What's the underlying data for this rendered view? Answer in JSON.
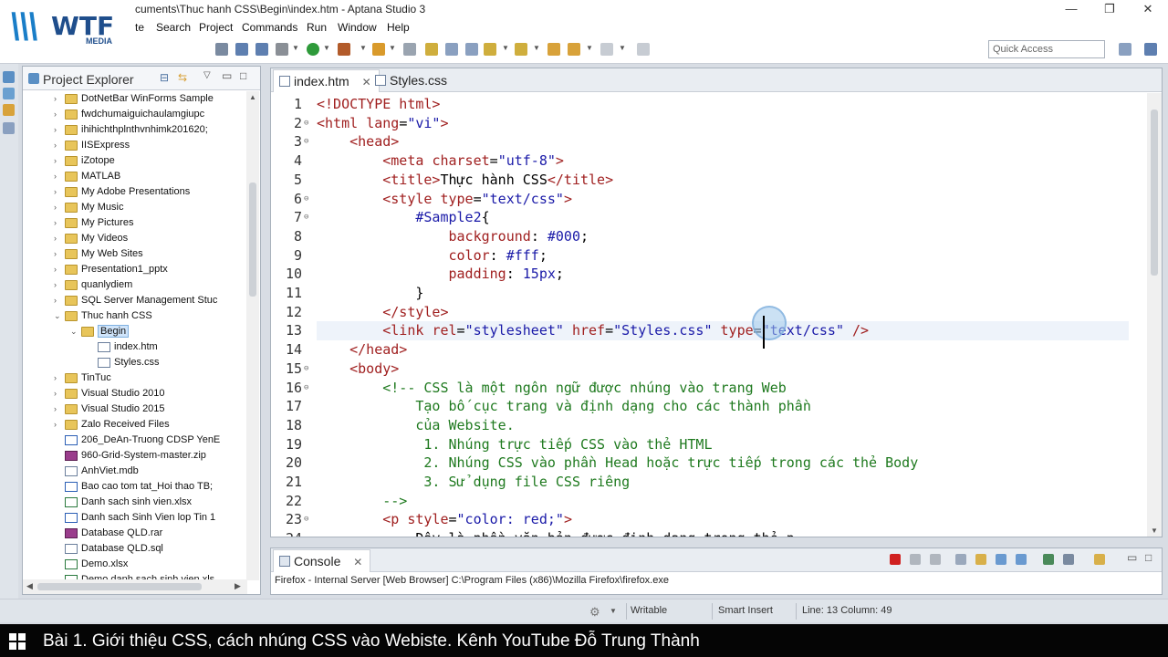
{
  "window": {
    "title": "cuments\\Thuc hanh CSS\\Begin\\index.htm - Aptana Studio 3",
    "minimize": "—",
    "restore": "❐",
    "close": "✕"
  },
  "logo": {
    "mark": "\\\\\\",
    "text": "WTF",
    "sub": "MEDIA"
  },
  "menu": [
    "te",
    "Search",
    "Project",
    "Commands",
    "Run",
    "Window",
    "Help"
  ],
  "quick_access": {
    "placeholder": "Quick Access"
  },
  "project_explorer": {
    "title": "Project Explorer",
    "items": [
      {
        "label": "DotNetBar WinForms Sample",
        "type": "folder",
        "depth": 1,
        "expanded": false
      },
      {
        "label": "fwdchumaiguichaulamgiupc",
        "type": "folder",
        "depth": 1,
        "expanded": false
      },
      {
        "label": "ihihichthplnthvnhimk201620;",
        "type": "folder",
        "depth": 1,
        "expanded": false
      },
      {
        "label": "IISExpress",
        "type": "folder",
        "depth": 1,
        "expanded": false
      },
      {
        "label": "iZotope",
        "type": "folder",
        "depth": 1,
        "expanded": false
      },
      {
        "label": "MATLAB",
        "type": "folder",
        "depth": 1,
        "expanded": false
      },
      {
        "label": "My Adobe Presentations",
        "type": "folder",
        "depth": 1,
        "expanded": false
      },
      {
        "label": "My Music",
        "type": "folder",
        "depth": 1,
        "expanded": false
      },
      {
        "label": "My Pictures",
        "type": "folder",
        "depth": 1,
        "expanded": false
      },
      {
        "label": "My Videos",
        "type": "folder",
        "depth": 1,
        "expanded": false
      },
      {
        "label": "My Web Sites",
        "type": "folder",
        "depth": 1,
        "expanded": false
      },
      {
        "label": "Presentation1_pptx",
        "type": "folder",
        "depth": 1,
        "expanded": false
      },
      {
        "label": "quanlydiem",
        "type": "folder",
        "depth": 1,
        "expanded": false
      },
      {
        "label": "SQL Server Management Stuc",
        "type": "folder",
        "depth": 1,
        "expanded": false
      },
      {
        "label": "Thuc hanh CSS",
        "type": "folder",
        "depth": 1,
        "expanded": true
      },
      {
        "label": "Begin",
        "type": "folder",
        "depth": 2,
        "expanded": true,
        "selected": true
      },
      {
        "label": "index.htm",
        "type": "file",
        "depth": 3
      },
      {
        "label": "Styles.css",
        "type": "file",
        "depth": 3
      },
      {
        "label": "TinTuc",
        "type": "folder",
        "depth": 1,
        "expanded": false
      },
      {
        "label": "Visual Studio 2010",
        "type": "folder",
        "depth": 1,
        "expanded": false
      },
      {
        "label": "Visual Studio 2015",
        "type": "folder",
        "depth": 1,
        "expanded": false
      },
      {
        "label": "Zalo Received Files",
        "type": "folder",
        "depth": 1,
        "expanded": false
      },
      {
        "label": "206_DeAn-Truong CDSP YenE",
        "type": "doc",
        "depth": 1
      },
      {
        "label": "960-Grid-System-master.zip",
        "type": "rar",
        "depth": 1
      },
      {
        "label": "AnhViet.mdb",
        "type": "file",
        "depth": 1
      },
      {
        "label": "Bao cao tom tat_Hoi thao TB;",
        "type": "doc",
        "depth": 1
      },
      {
        "label": "Danh sach sinh vien.xlsx",
        "type": "xls",
        "depth": 1
      },
      {
        "label": "Danh sach Sinh Vien lop Tin 1",
        "type": "doc",
        "depth": 1
      },
      {
        "label": "Database QLD.rar",
        "type": "rar",
        "depth": 1
      },
      {
        "label": "Database QLD.sql",
        "type": "file",
        "depth": 1
      },
      {
        "label": "Demo.xlsx",
        "type": "xls",
        "depth": 1
      },
      {
        "label": "Demo danh sach sinh vien.xls",
        "type": "xls",
        "depth": 1
      }
    ]
  },
  "editor": {
    "tabs": [
      {
        "label": "index.htm",
        "active": true,
        "close": "✕"
      },
      {
        "label": "Styles.css",
        "active": false
      }
    ],
    "current_line": 13,
    "lines": [
      {
        "n": "1",
        "fold": "",
        "parts": [
          [
            "tg",
            "<!DOCTYPE html>"
          ]
        ]
      },
      {
        "n": "2",
        "fold": "⊖",
        "parts": [
          [
            "tg",
            "<html "
          ],
          [
            "at",
            "lang"
          ],
          [
            "tx2",
            "="
          ],
          [
            "av",
            "\"vi\""
          ],
          [
            "tg",
            ">"
          ]
        ]
      },
      {
        "n": "3",
        "fold": "⊖",
        "parts": [
          [
            "tx2",
            "    "
          ],
          [
            "tg",
            "<head>"
          ]
        ]
      },
      {
        "n": "4",
        "fold": "",
        "parts": [
          [
            "tx2",
            "        "
          ],
          [
            "tg",
            "<meta "
          ],
          [
            "at",
            "charset"
          ],
          [
            "tx2",
            "="
          ],
          [
            "av",
            "\"utf-8\""
          ],
          [
            "tg",
            ">"
          ]
        ]
      },
      {
        "n": "5",
        "fold": "",
        "parts": [
          [
            "tx2",
            "        "
          ],
          [
            "tg",
            "<title>"
          ],
          [
            "tx2",
            "Thực hành CSS"
          ],
          [
            "tg",
            "</title>"
          ]
        ]
      },
      {
        "n": "6",
        "fold": "⊖",
        "parts": [
          [
            "tx2",
            "        "
          ],
          [
            "tg",
            "<style "
          ],
          [
            "at",
            "type"
          ],
          [
            "tx2",
            "="
          ],
          [
            "av",
            "\"text/css\""
          ],
          [
            "tg",
            ">"
          ]
        ]
      },
      {
        "n": "7",
        "fold": "⊖",
        "parts": [
          [
            "tx2",
            "            "
          ],
          [
            "se",
            "#Sample2"
          ],
          [
            "tx2",
            "{"
          ]
        ]
      },
      {
        "n": "8",
        "fold": "",
        "parts": [
          [
            "tx2",
            "                "
          ],
          [
            "pr",
            "background"
          ],
          [
            "tx2",
            ": "
          ],
          [
            "vl",
            "#000"
          ],
          [
            "tx2",
            ";"
          ]
        ]
      },
      {
        "n": "9",
        "fold": "",
        "parts": [
          [
            "tx2",
            "                "
          ],
          [
            "pr",
            "color"
          ],
          [
            "tx2",
            ": "
          ],
          [
            "vl",
            "#fff"
          ],
          [
            "tx2",
            ";"
          ]
        ]
      },
      {
        "n": "10",
        "fold": "",
        "parts": [
          [
            "tx2",
            "                "
          ],
          [
            "pr",
            "padding"
          ],
          [
            "tx2",
            ": "
          ],
          [
            "vl",
            "15px"
          ],
          [
            "tx2",
            ";"
          ]
        ]
      },
      {
        "n": "11",
        "fold": "",
        "parts": [
          [
            "tx2",
            "            }"
          ]
        ]
      },
      {
        "n": "12",
        "fold": "",
        "parts": [
          [
            "tx2",
            "        "
          ],
          [
            "tg",
            "</style>"
          ]
        ]
      },
      {
        "n": "13",
        "fold": "",
        "parts": [
          [
            "tx2",
            "        "
          ],
          [
            "tg",
            "<link "
          ],
          [
            "at",
            "rel"
          ],
          [
            "tx2",
            "="
          ],
          [
            "av",
            "\"stylesheet\""
          ],
          [
            "tx2",
            " "
          ],
          [
            "at",
            "href"
          ],
          [
            "tx2",
            "="
          ],
          [
            "av",
            "\"Styles.css\""
          ],
          [
            "tx2",
            " "
          ],
          [
            "at",
            "type"
          ],
          [
            "tx2",
            "="
          ],
          [
            "av",
            "\"text/css\""
          ],
          [
            "tx2",
            " "
          ],
          [
            "tg",
            "/>"
          ]
        ]
      },
      {
        "n": "14",
        "fold": "",
        "parts": [
          [
            "tx2",
            "    "
          ],
          [
            "tg",
            "</head>"
          ]
        ]
      },
      {
        "n": "15",
        "fold": "⊖",
        "parts": [
          [
            "tx2",
            "    "
          ],
          [
            "tg",
            "<body>"
          ]
        ]
      },
      {
        "n": "16",
        "fold": "⊖",
        "parts": [
          [
            "tx2",
            "        "
          ],
          [
            "cm",
            "<!-- CSS là một ngôn ngữ được nhúng vào trang Web"
          ]
        ]
      },
      {
        "n": "17",
        "fold": "",
        "parts": [
          [
            "cm",
            "            Tạo bố cục trang và định dạng cho các thành phần"
          ]
        ]
      },
      {
        "n": "18",
        "fold": "",
        "parts": [
          [
            "cm",
            "            của Website."
          ]
        ]
      },
      {
        "n": "19",
        "fold": "",
        "parts": [
          [
            "cm",
            "             1. Nhúng trực tiếp CSS vào thẻ HTML"
          ]
        ]
      },
      {
        "n": "20",
        "fold": "",
        "parts": [
          [
            "cm",
            "             2. Nhúng CSS vào phần Head hoặc trực tiếp trong các thẻ Body"
          ]
        ]
      },
      {
        "n": "21",
        "fold": "",
        "parts": [
          [
            "cm",
            "             3. Sử dụng file CSS riêng"
          ]
        ]
      },
      {
        "n": "22",
        "fold": "",
        "parts": [
          [
            "cm",
            "        -->"
          ]
        ]
      },
      {
        "n": "23",
        "fold": "⊖",
        "parts": [
          [
            "tx2",
            "        "
          ],
          [
            "tg",
            "<p "
          ],
          [
            "at",
            "style"
          ],
          [
            "tx2",
            "="
          ],
          [
            "av",
            "\"color: red;\""
          ],
          [
            "tg",
            ">"
          ]
        ]
      },
      {
        "n": "24",
        "fold": "",
        "parts": [
          [
            "tx2",
            "            Đây là phần văn bản được định dạng trong thẻ p"
          ]
        ]
      }
    ]
  },
  "console": {
    "tab": "Console",
    "close": "✕",
    "output": "Firefox - Internal Server [Web Browser] C:\\Program Files (x86)\\Mozilla Firefox\\firefox.exe"
  },
  "status": {
    "writable": "Writable",
    "insert": "Smart Insert",
    "position": "Line: 13 Column: 49"
  },
  "caption": "Bài 1. Giới thiệu CSS, cách nhúng CSS vào Webiste. Kênh YouTube Đỗ Trung Thành",
  "colors": {
    "tag": "#a02020",
    "attr_value": "#1a1aa8",
    "comment": "#1f7a1f",
    "caption_bg": "#050505"
  }
}
